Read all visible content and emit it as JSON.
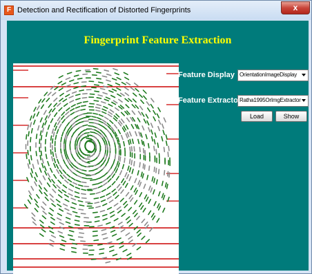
{
  "window": {
    "title": "Detection and Rectification of Distorted Fingerprints",
    "icon_letter": "F",
    "close_glyph": "x"
  },
  "form": {
    "heading": "Fingerprint Feature Extraction",
    "feature_display": {
      "label": "Feature Display",
      "value": "OrientationImageDisplay"
    },
    "feature_extractor": {
      "label": "Feature Extractor",
      "value": "Ratha1995OrImgExtractor"
    },
    "load_label": "Load",
    "show_label": "Show"
  },
  "colors": {
    "client_bg": "#007b7b",
    "heading": "#ffff00",
    "ridge_orientation": "#1e7a1e",
    "stripe": "#cc0000"
  }
}
